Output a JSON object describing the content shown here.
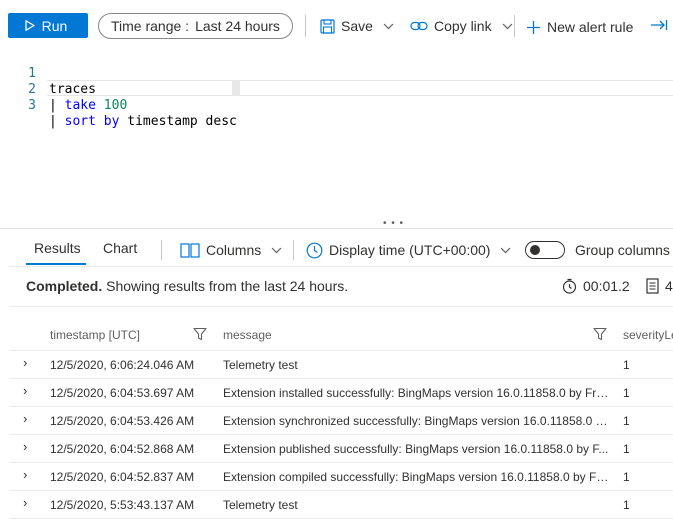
{
  "toolbar": {
    "run_label": "Run",
    "time_range_label": "Time range :",
    "time_range_value": "Last 24 hours",
    "save_label": "Save",
    "copy_link_label": "Copy link",
    "new_alert_label": "New alert rule"
  },
  "editor": {
    "lines": [
      {
        "num": "1",
        "text": "traces"
      },
      {
        "num": "2",
        "pipe": "| ",
        "kw": "take",
        "arg": "100"
      },
      {
        "num": "3",
        "pipe": "| ",
        "kw": "sort by",
        "rest": " timestamp desc"
      }
    ]
  },
  "results": {
    "tabs": [
      {
        "label": "Results",
        "active": true
      },
      {
        "label": "Chart",
        "active": false
      }
    ],
    "columns_label": "Columns",
    "display_time_label": "Display time (UTC+00:00)",
    "group_columns_label": "Group columns",
    "status_bold": "Completed.",
    "status_text": "Showing results from the last 24 hours.",
    "duration": "00:01.2",
    "record_count_partial": "4"
  },
  "table": {
    "headers": [
      "timestamp [UTC]",
      "message",
      "severityLe"
    ],
    "rows": [
      {
        "timestamp": "12/5/2020, 6:06:24.046 AM",
        "message": "Telemetry test",
        "severity": "1"
      },
      {
        "timestamp": "12/5/2020, 6:04:53.697 AM",
        "message": "Extension installed successfully: BingMaps version 16.0.11858.0 by Fre...",
        "severity": "1"
      },
      {
        "timestamp": "12/5/2020, 6:04:53.426 AM",
        "message": "Extension synchronized successfully: BingMaps version 16.0.11858.0 b...",
        "severity": "1"
      },
      {
        "timestamp": "12/5/2020, 6:04:52.868 AM",
        "message": "Extension published successfully: BingMaps version 16.0.11858.0 by F...",
        "severity": "1"
      },
      {
        "timestamp": "12/5/2020, 6:04:52.837 AM",
        "message": "Extension compiled successfully: BingMaps version 16.0.11858.0 by Fr...",
        "severity": "1"
      },
      {
        "timestamp": "12/5/2020, 5:53:43.137 AM",
        "message": "Telemetry test",
        "severity": "1"
      }
    ]
  },
  "colors": {
    "accent": "#0078d4",
    "keyword": "#0000ff",
    "number": "#098658",
    "line_number": "#237893"
  },
  "icons": [
    "play-icon",
    "save-icon",
    "link-icon",
    "plus-icon",
    "export-icon",
    "columns-icon",
    "clock-icon",
    "timer-icon",
    "records-icon",
    "filter-icon",
    "chevron-right-icon"
  ]
}
